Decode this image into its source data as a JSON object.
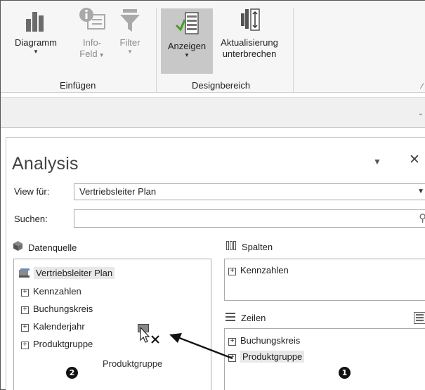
{
  "ribbon": {
    "buttons": {
      "diagramm": "Diagramm",
      "info_1": "Info-",
      "info_2": "Feld",
      "filter": "Filter",
      "anzeigen": "Anzeigen",
      "aktualisierung_1": "Aktualisierung",
      "aktualisierung_2": "unterbrechen"
    },
    "groups": {
      "einfuegen": "Einfügen",
      "designbereich": "Designbereich"
    }
  },
  "pane": {
    "title": "Analysis",
    "view_label": "View für:",
    "view_value": "Vertriebsleiter Plan",
    "search_label": "Suchen:",
    "search_value": "",
    "datenquelle": {
      "heading": "Datenquelle",
      "root": "Vertriebsleiter Plan",
      "items": [
        "Kennzahlen",
        "Buchungskreis",
        "Kalenderjahr",
        "Produktgruppe"
      ]
    },
    "spalten": {
      "heading": "Spalten",
      "items": [
        "Kennzahlen"
      ]
    },
    "zeilen": {
      "heading": "Zeilen",
      "items": [
        "Buchungskreis",
        "Produktgruppe"
      ]
    },
    "drag_label": "Produktgruppe",
    "callouts": [
      "1",
      "2"
    ]
  },
  "colors": {
    "ribbon_bg": "#f6f6f6",
    "selected_button": "#c8c8c8",
    "chart_icon": "#6b6b6b",
    "disabled_icon": "#a9a9a9",
    "highlight": "#e8e8e8",
    "check_green": "#4c9a2a"
  },
  "icons": [
    "chart-icon",
    "info-icon",
    "filter-icon",
    "show-panes-icon",
    "defer-update-icon",
    "cube-icon",
    "columns-icon",
    "rows-icon",
    "search-icon",
    "close-icon",
    "cursor-icon",
    "arrow-icon"
  ]
}
